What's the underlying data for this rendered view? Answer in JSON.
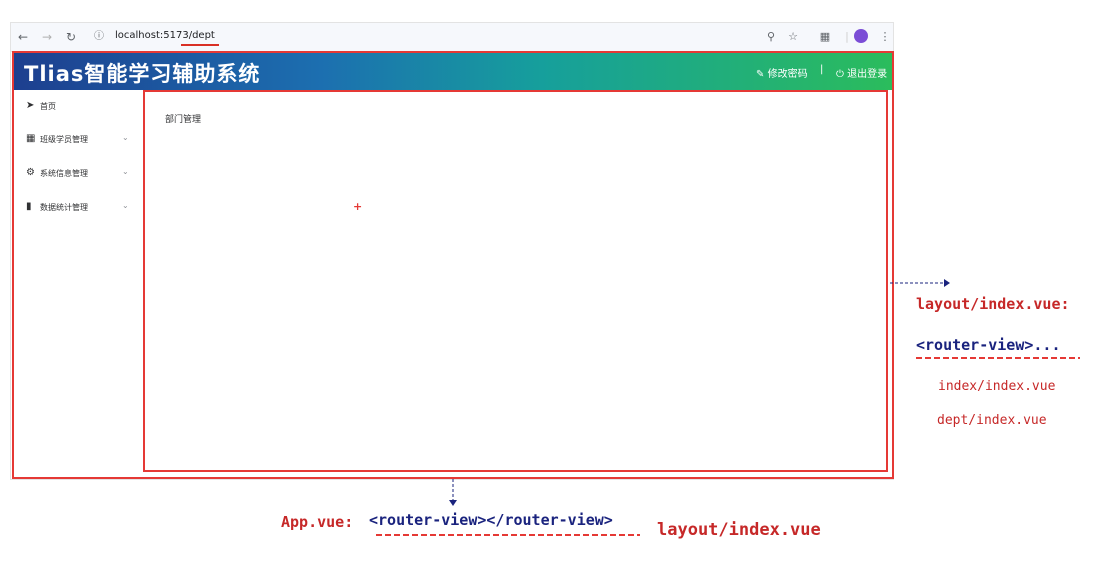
{
  "browser": {
    "url": "localhost:5173/dept"
  },
  "header": {
    "logo": "Tlias智能学习辅助系统",
    "change_password": "修改密码",
    "separator": "|",
    "logout": "退出登录"
  },
  "sidebar": {
    "items": [
      {
        "icon": "paper-plane-icon",
        "label": "首页",
        "has_arrow": false
      },
      {
        "icon": "grid-icon",
        "label": "班级学员管理",
        "has_arrow": true
      },
      {
        "icon": "gear-icon",
        "label": "系统信息管理",
        "has_arrow": true
      },
      {
        "icon": "bar-chart-icon",
        "label": "数据统计管理",
        "has_arrow": true
      }
    ]
  },
  "content": {
    "title": "部门管理",
    "marker": "+"
  },
  "annotations": {
    "right": {
      "heading": "layout/index.vue:",
      "router_view": "<router-view>...",
      "item1": "index/index.vue",
      "item2": "dept/index.vue"
    },
    "bottom": {
      "label": "App.vue:",
      "router_view": "<router-view></router-view>",
      "target": "layout/index.vue"
    }
  },
  "colors": {
    "annotation_red": "#c62828",
    "annotation_navy": "#1a237e",
    "frame_red": "#e53935"
  }
}
